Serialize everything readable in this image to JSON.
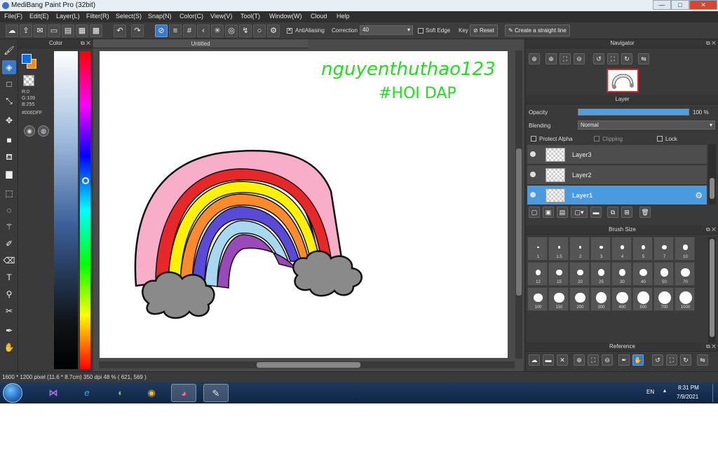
{
  "window": {
    "title": "MediBang Paint Pro (32bit)",
    "minimize": "—",
    "maximize": "□",
    "close": "✕"
  },
  "menu": [
    "File(F)",
    "Edit(E)",
    "Layer(L)",
    "Filter(R)",
    "Select(S)",
    "Snap(N)",
    "Color(C)",
    "View(V)",
    "Tool(T)",
    "Window(W)",
    "Cloud",
    "Help"
  ],
  "toolbar": {
    "antialiasing_label": "AntiAliasing",
    "correction_label": "Correction",
    "correction_value": "40",
    "soft_edge_label": "Soft Edge",
    "key_label": "Key",
    "reset_label": "Reset",
    "straight_line_label": "Create a straight line"
  },
  "color_panel": {
    "title": "Color",
    "r": "R:0",
    "g": "G:109",
    "b": "B:255",
    "hex": "#006DFF",
    "foreground": "#006dff",
    "background": "#ff8c00"
  },
  "canvas": {
    "tab": "Untitled",
    "handwriting_line1": "nguyenthuthao123",
    "handwriting_line2": "#HOI DAP"
  },
  "navigator": {
    "title": "Navigator"
  },
  "layer_panel": {
    "title": "Layer",
    "opacity_label": "Opacity",
    "opacity_value": "100 %",
    "opacity": 1.0,
    "blending_label": "Blending",
    "blending_value": "Normal",
    "protect_alpha": "Protect Alpha",
    "clipping": "Clipping",
    "lock": "Lock",
    "layers": [
      {
        "name": "Layer3",
        "selected": false
      },
      {
        "name": "Layer2",
        "selected": false
      },
      {
        "name": "Layer1",
        "selected": true
      }
    ]
  },
  "brush_size": {
    "title": "Brush Size",
    "sizes": [
      "1",
      "1.5",
      "2",
      "3",
      "4",
      "5",
      "7",
      "10",
      "12",
      "15",
      "20",
      "25",
      "30",
      "40",
      "50",
      "70",
      "100",
      "150",
      "200",
      "300",
      "400",
      "500",
      "700",
      "1000"
    ]
  },
  "reference": {
    "title": "Reference"
  },
  "status": "1600 * 1200 pixel   (11.6 * 8.7cm)   350 dpi   48 %   ( 621, 569 )",
  "taskbar": {
    "lang": "EN",
    "time": "8:31 PM",
    "date": "7/9/2021"
  },
  "colors": {
    "accent": "#3a78c8",
    "panel": "#3a3a3a",
    "rainbow": [
      "#f8aec8",
      "#e82828",
      "#fff200",
      "#ff8a2a",
      "#5a4ad8",
      "#a8d8f0",
      "#9a4ab8"
    ],
    "cloud": "#8a8a8a",
    "handwriting": "#22dd22"
  }
}
